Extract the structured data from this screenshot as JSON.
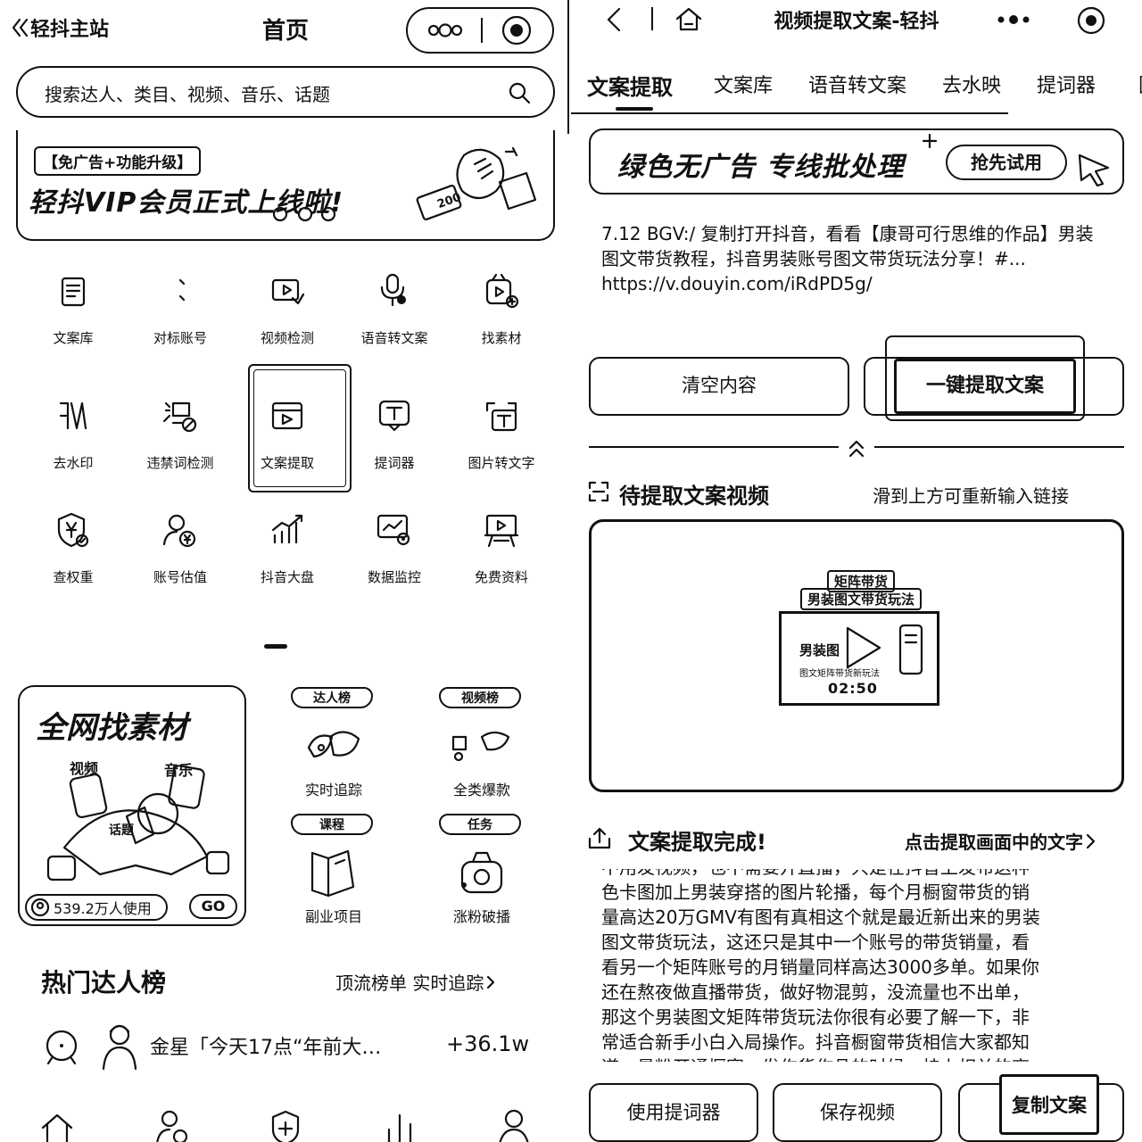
{
  "left": {
    "back_label": "轻抖主站",
    "title": "首页",
    "search_placeholder": "搜索达人、类目、视频、音乐、话题",
    "banner": {
      "tag": "【免广告+功能升级】",
      "headline": "轻抖VIP会员正式上线啦!",
      "badge": "200"
    },
    "tools": [
      {
        "label": "文案库",
        "icon": "document-library-icon"
      },
      {
        "label": "对标账号",
        "icon": "user-match-icon"
      },
      {
        "label": "视频检测",
        "icon": "video-check-icon"
      },
      {
        "label": "语音转文案",
        "icon": "voice-to-text-icon"
      },
      {
        "label": "找素材",
        "icon": "find-material-icon"
      },
      {
        "label": "去水印",
        "icon": "remove-watermark-icon"
      },
      {
        "label": "违禁词检测",
        "icon": "banned-words-icon"
      },
      {
        "label": "文案提取",
        "icon": "text-extract-icon"
      },
      {
        "label": "提词器",
        "icon": "teleprompter-icon"
      },
      {
        "label": "图片转文字",
        "icon": "image-to-text-icon"
      },
      {
        "label": "查权重",
        "icon": "weight-check-icon"
      },
      {
        "label": "账号估值",
        "icon": "account-value-icon"
      },
      {
        "label": "抖音大盘",
        "icon": "market-chart-icon"
      },
      {
        "label": "数据监控",
        "icon": "data-monitor-icon"
      },
      {
        "label": "免费资料",
        "icon": "free-resources-icon"
      }
    ],
    "material_card": {
      "title": "全网找素材",
      "users": "539.2万人使用",
      "go": "GO",
      "stickers": [
        "视频",
        "音乐",
        "话题"
      ]
    },
    "feature_cards": [
      {
        "tag": "达人榜",
        "label": "实时追踪"
      },
      {
        "tag": "视频榜",
        "label": "全类爆款"
      },
      {
        "tag": "课程",
        "label": "副业项目"
      },
      {
        "tag": "任务",
        "label": "涨粉破播"
      }
    ],
    "hot_section": {
      "title": "热门达人榜",
      "link": "顶流榜单 实时追踪",
      "row": {
        "name": "金星「今天17点“年前大…",
        "growth": "+36.1w"
      }
    },
    "bottom_nav": [
      "home-icon",
      "user-icon",
      "shield-icon",
      "chart-icon",
      "profile-icon"
    ]
  },
  "right": {
    "title": "视频提取文案-轻抖",
    "tabs": [
      "文案提取",
      "文案库",
      "语音转文案",
      "去水映",
      "提词器",
      "图"
    ],
    "active_tab": 0,
    "ad_banner": {
      "text": "绿色无广告 专线批处理",
      "button": "抢先试用"
    },
    "input_text": "7.12 BGV:/ 复制打开抖音，看看【康哥可行思维的作品】男装图文带货教程，抖音男装账号图文带货玩法分享！#... https://v.douyin.com/iRdPD5g/",
    "clear_button": "清空内容",
    "extract_button": "一键提取文案",
    "pending": {
      "title": "待提取文案视频",
      "hint": "滑到上方可重新输入链接"
    },
    "video": {
      "tag1": "矩阵带货",
      "tag2": "男装图文带货玩法",
      "thumb_text": "男装图",
      "thumb_sub": "图文矩阵带货新玩法",
      "duration": "02:50"
    },
    "result": {
      "title": "文案提取完成!",
      "hint": "点击提取画面中的文字",
      "lines": [
        "不用发视频，也不需要开直播，只是在抖音上发布这种",
        "色卡图加上男装穿搭的图片轮播，每个月橱窗带货的销",
        "量高达20万GMV有图有真相这个就是最近新出来的男装",
        "图文带货玩法，这还只是其中一个账号的带货销量，看",
        "看另一个矩阵账号的月销量同样高达3000多单。如果你",
        "还在熬夜做直播带货，做好物混剪，没流量也不出单，",
        "那这个男装图文矩阵带货玩法你很有必要了解一下，非",
        "常适合新手小白入局操作。抖音橱窗带货相信大家都知",
        "道，最粉开通橱窗，发作货作品的时候，挂上相关的商"
      ]
    },
    "actions": [
      "使用提词器",
      "保存视频",
      "复制文案"
    ]
  }
}
